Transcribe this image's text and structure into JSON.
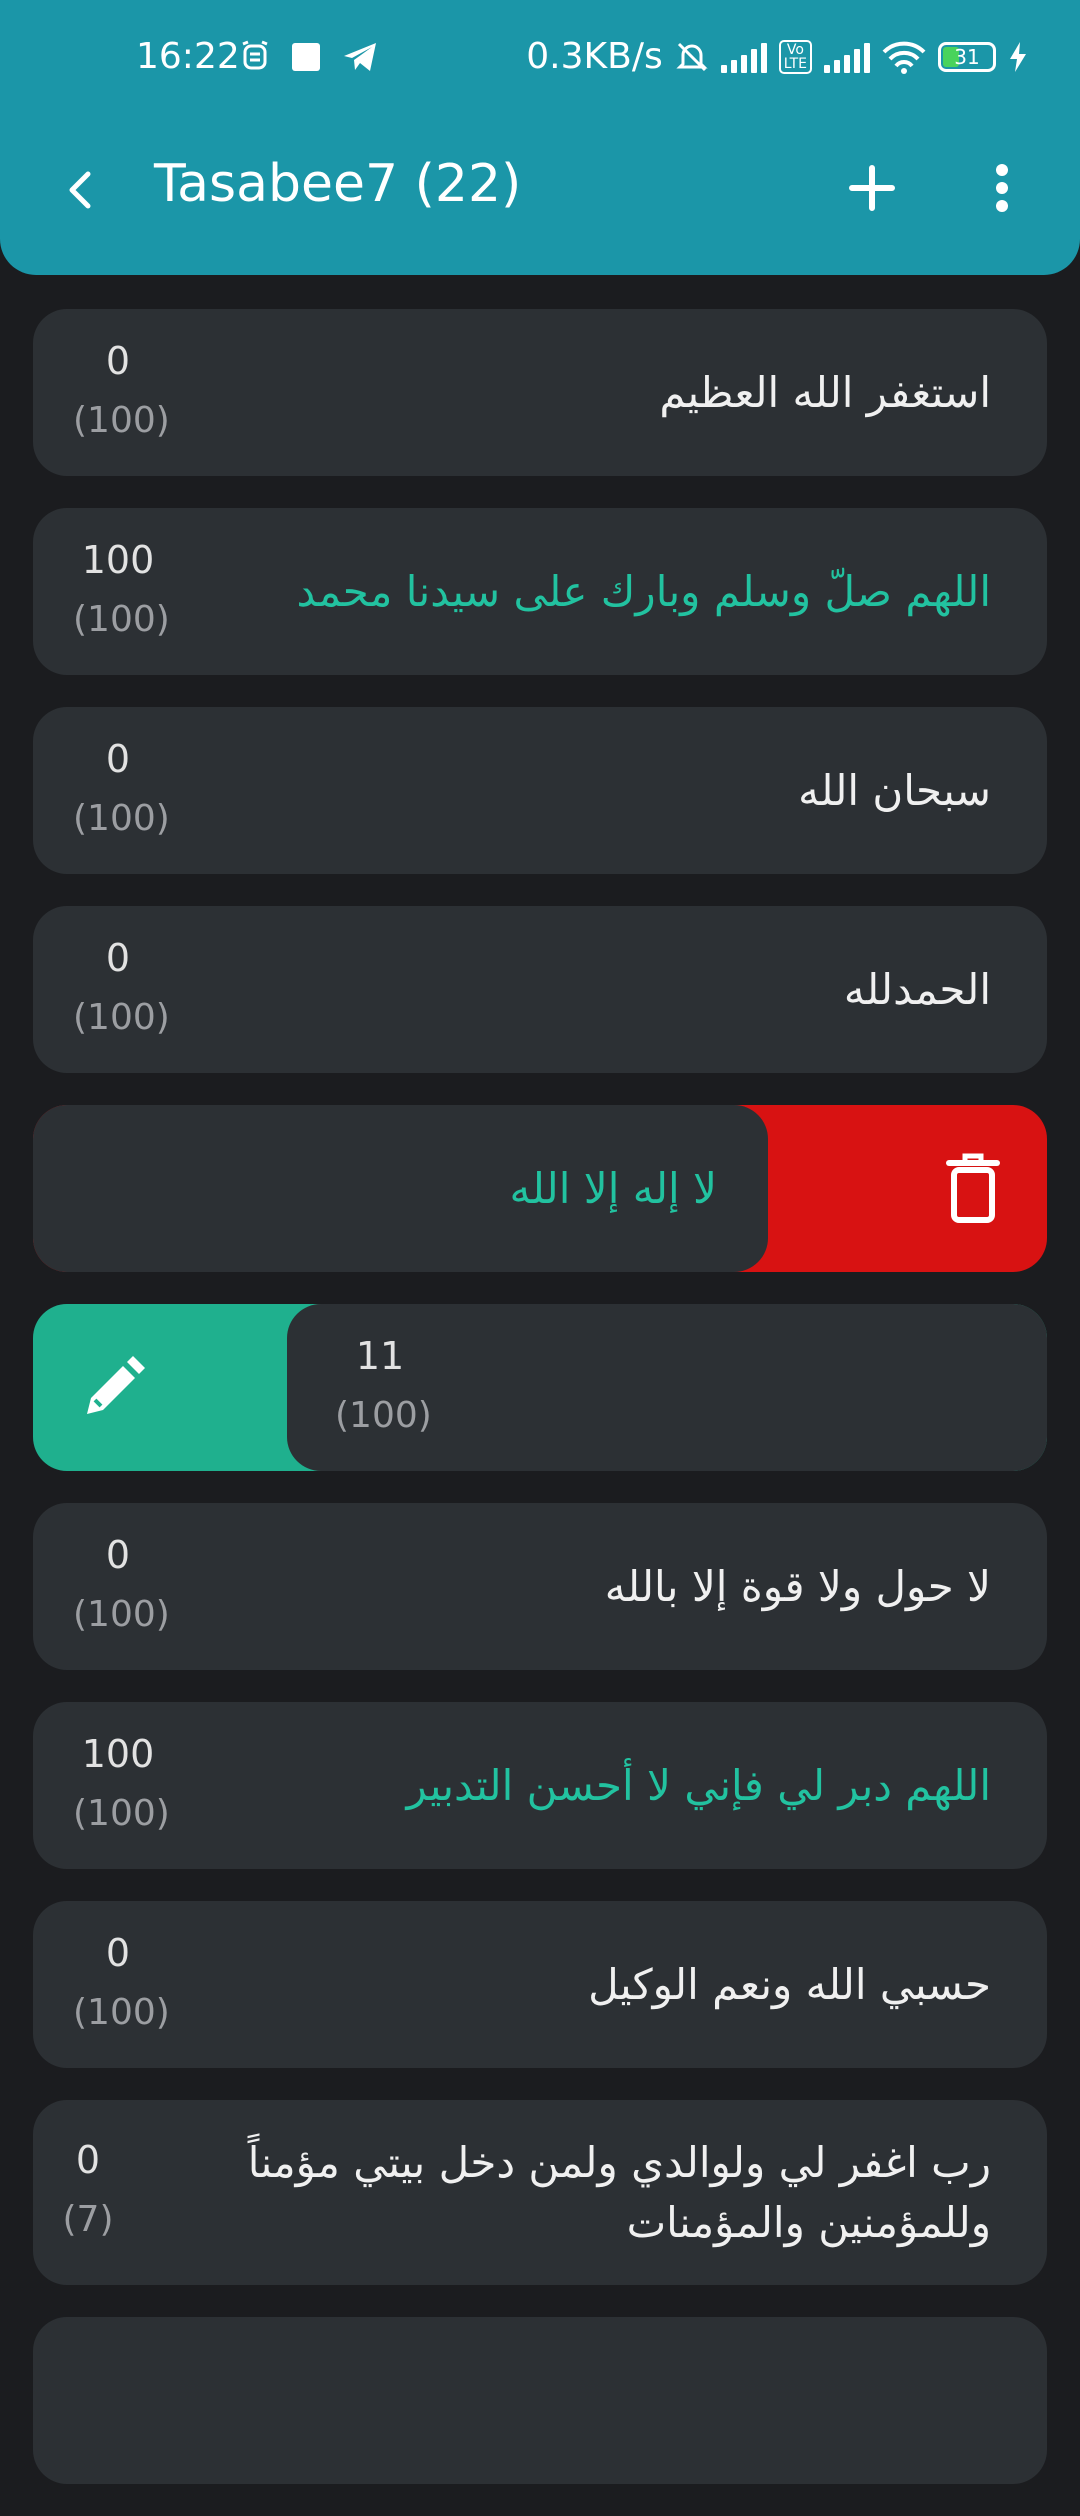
{
  "status_bar": {
    "time": "16:22",
    "net_speed": "0.3KB/s",
    "battery": "31",
    "icons": [
      "alarm-clock-icon",
      "square-icon",
      "telegram-icon",
      "bell-off-icon",
      "signal-icon",
      "volte-icon",
      "signal-icon",
      "wifi-icon",
      "battery-icon",
      "charging-icon"
    ]
  },
  "toolbar": {
    "title": "Tasabee7 (22)",
    "icons": [
      "back-arrow-icon",
      "add-icon",
      "more-vert-icon"
    ]
  },
  "colors": {
    "header": "#1b96a8",
    "card": "#2c3034",
    "background": "#1b1c1f",
    "completed_text": "#22c2a0",
    "delete": "#d81212",
    "edit": "#1fb08e"
  },
  "items": [
    {
      "text": "استغفر الله العظيم",
      "count": "0",
      "target": "(100)"
    },
    {
      "text": "اللهم صلّ وسلم وبارك على سيدنا محمد",
      "count": "100",
      "target": "(100)"
    },
    {
      "text": "سبحان الله",
      "count": "0",
      "target": "(100)"
    },
    {
      "text": "الحمدلله",
      "count": "0",
      "target": "(100)"
    },
    {
      "text": "لا إله إلا الله",
      "count": "",
      "target": ""
    },
    {
      "text": "",
      "count": "11",
      "target": "(100)"
    },
    {
      "text": "لا حول ولا قوة إلا بالله",
      "count": "0",
      "target": "(100)"
    },
    {
      "text": "اللهم دبر لي فإني لا أحسن التدبير",
      "count": "100",
      "target": "(100)"
    },
    {
      "text": "حسبي الله ونعم الوكيل",
      "count": "0",
      "target": "(100)"
    },
    {
      "text": "رب اغفر لي ولوالدي ولمن دخل بيتي مؤمناً وللمؤمنين والمؤمنات",
      "count": "0",
      "target": "(7)"
    }
  ]
}
